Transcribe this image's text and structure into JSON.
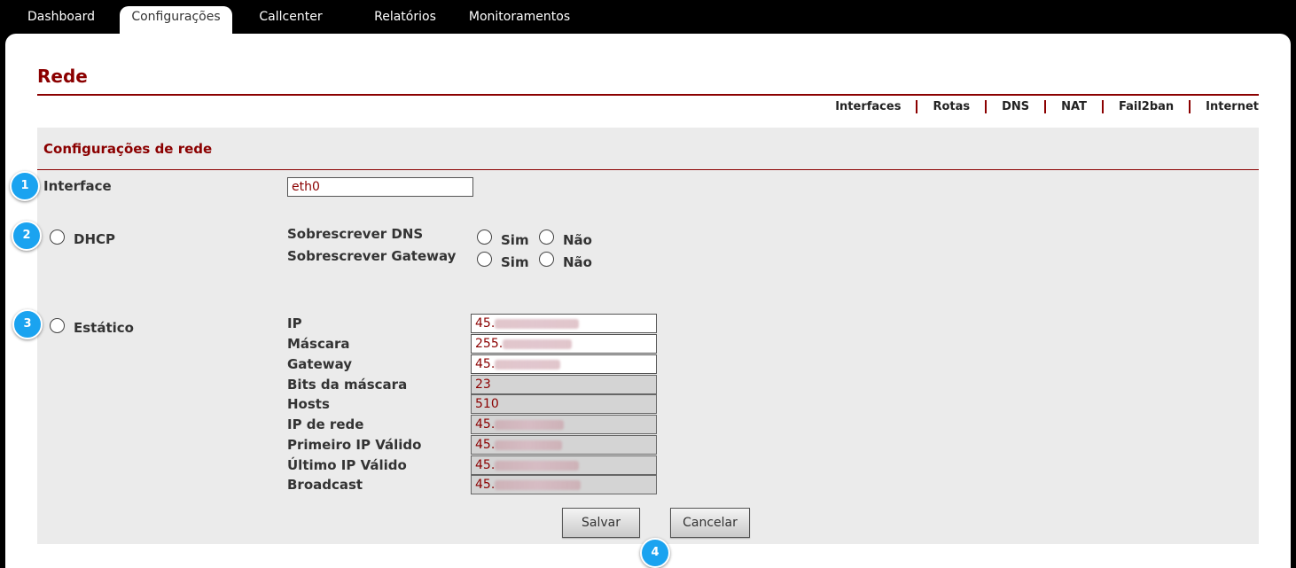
{
  "topnav": {
    "tabs": [
      {
        "label": "Dashboard",
        "active": false
      },
      {
        "label": "Configurações",
        "active": true
      },
      {
        "label": "Callcenter",
        "active": false
      },
      {
        "label": "Relatórios",
        "active": false
      },
      {
        "label": "Monitoramentos",
        "active": false
      }
    ]
  },
  "page": {
    "title": "Rede",
    "subnav": [
      "Interfaces",
      "Rotas",
      "DNS",
      "NAT",
      "Fail2ban",
      "Internet"
    ]
  },
  "form": {
    "section_title": "Configurações de rede",
    "interface": {
      "label": "Interface",
      "value": "eth0"
    },
    "dhcp": {
      "label": "DHCP",
      "dns_label": "Sobrescrever DNS",
      "gateway_label": "Sobrescrever Gateway",
      "yes": "Sim",
      "no": "Não"
    },
    "static": {
      "label": "Estático",
      "fields": [
        {
          "label": "IP",
          "value": "45.",
          "readonly": false
        },
        {
          "label": "Máscara",
          "value": "255.",
          "readonly": false
        },
        {
          "label": "Gateway",
          "value": "45.",
          "readonly": false
        },
        {
          "label": "Bits da máscara",
          "value": "23",
          "readonly": true
        },
        {
          "label": "Hosts",
          "value": "510",
          "readonly": true
        },
        {
          "label": "IP de rede",
          "value": "45.",
          "readonly": true
        },
        {
          "label": "Primeiro IP Válido",
          "value": "45.",
          "readonly": true
        },
        {
          "label": "Último IP Válido",
          "value": "45.",
          "readonly": true
        },
        {
          "label": "Broadcast",
          "value": "45.",
          "readonly": true
        }
      ]
    },
    "buttons": {
      "save": "Salvar",
      "cancel": "Cancelar"
    }
  },
  "annotations": [
    "1",
    "2",
    "3",
    "4"
  ],
  "colors": {
    "accent": "#8b0000",
    "badge": "#1aa3f0",
    "form_bg": "#ebebeb"
  }
}
